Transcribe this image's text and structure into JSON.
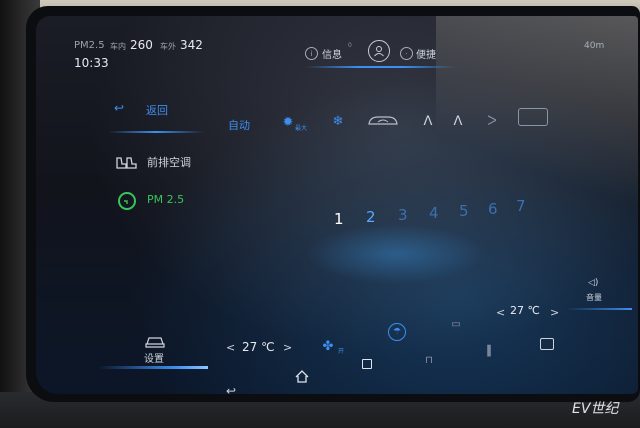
{
  "status": {
    "pm_label": "PM2.5",
    "inside_label": "车内",
    "inside_value": "260",
    "outside_label": "车外",
    "outside_value": "342",
    "time": "10:33",
    "distance": "40m"
  },
  "top_tabs": {
    "info": "信息",
    "info_badge": "0",
    "shortcut": "便捷"
  },
  "sidebar": {
    "back": "返回",
    "front_ac": "前排空调",
    "pm25": "PM 2.5",
    "settings": "设置"
  },
  "modes": {
    "auto": "自动",
    "max_label": "最大"
  },
  "fan_levels": [
    "1",
    "2",
    "3",
    "4",
    "5",
    "6",
    "7"
  ],
  "fan_level_active": 2,
  "bottom": {
    "left_temp": "27 ℃",
    "right_temp": "27 ℃",
    "fan_label": "开",
    "volume": "音量",
    "prev": "<",
    "next": ">"
  },
  "watermark": "EV世纪",
  "colors": {
    "accent": "#3d8ef0",
    "pm_ok": "#37c45a"
  }
}
